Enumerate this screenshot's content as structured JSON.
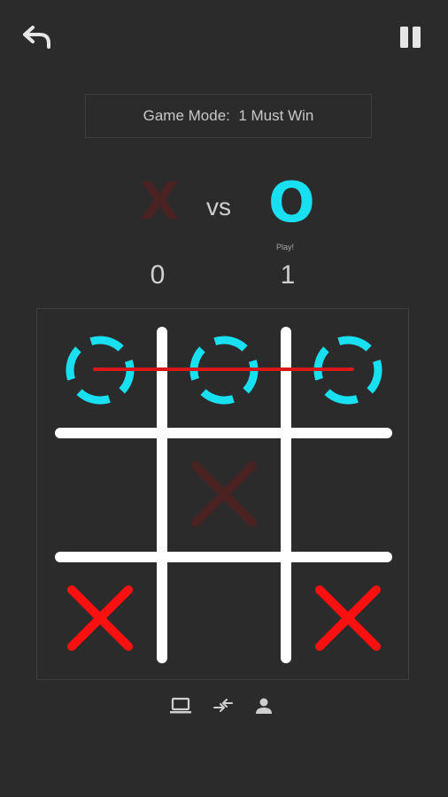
{
  "header": {
    "back_icon": "undo-arrow-icon",
    "pause_icon": "pause-icon"
  },
  "game_mode": {
    "label": "Game Mode:",
    "value": "1 Must Win"
  },
  "players": {
    "x_symbol": "X",
    "o_symbol": "O",
    "vs": "vs",
    "turn_tag": "Play!",
    "x_score": "0",
    "o_score": "1"
  },
  "board": {
    "cells": [
      "O",
      "O",
      "O",
      "",
      "X-faded",
      "",
      "X",
      "",
      "X"
    ],
    "winning_line": "top-row"
  },
  "colors": {
    "background": "#2b2b2b",
    "o_color": "#18e0f0",
    "x_color": "#ff1010",
    "x_faded": "#4a2222",
    "grid": "#ffffff",
    "win_line": "#d81818"
  },
  "bottom_icons": [
    "laptop-icon",
    "swap-arrows-icon",
    "person-icon"
  ]
}
